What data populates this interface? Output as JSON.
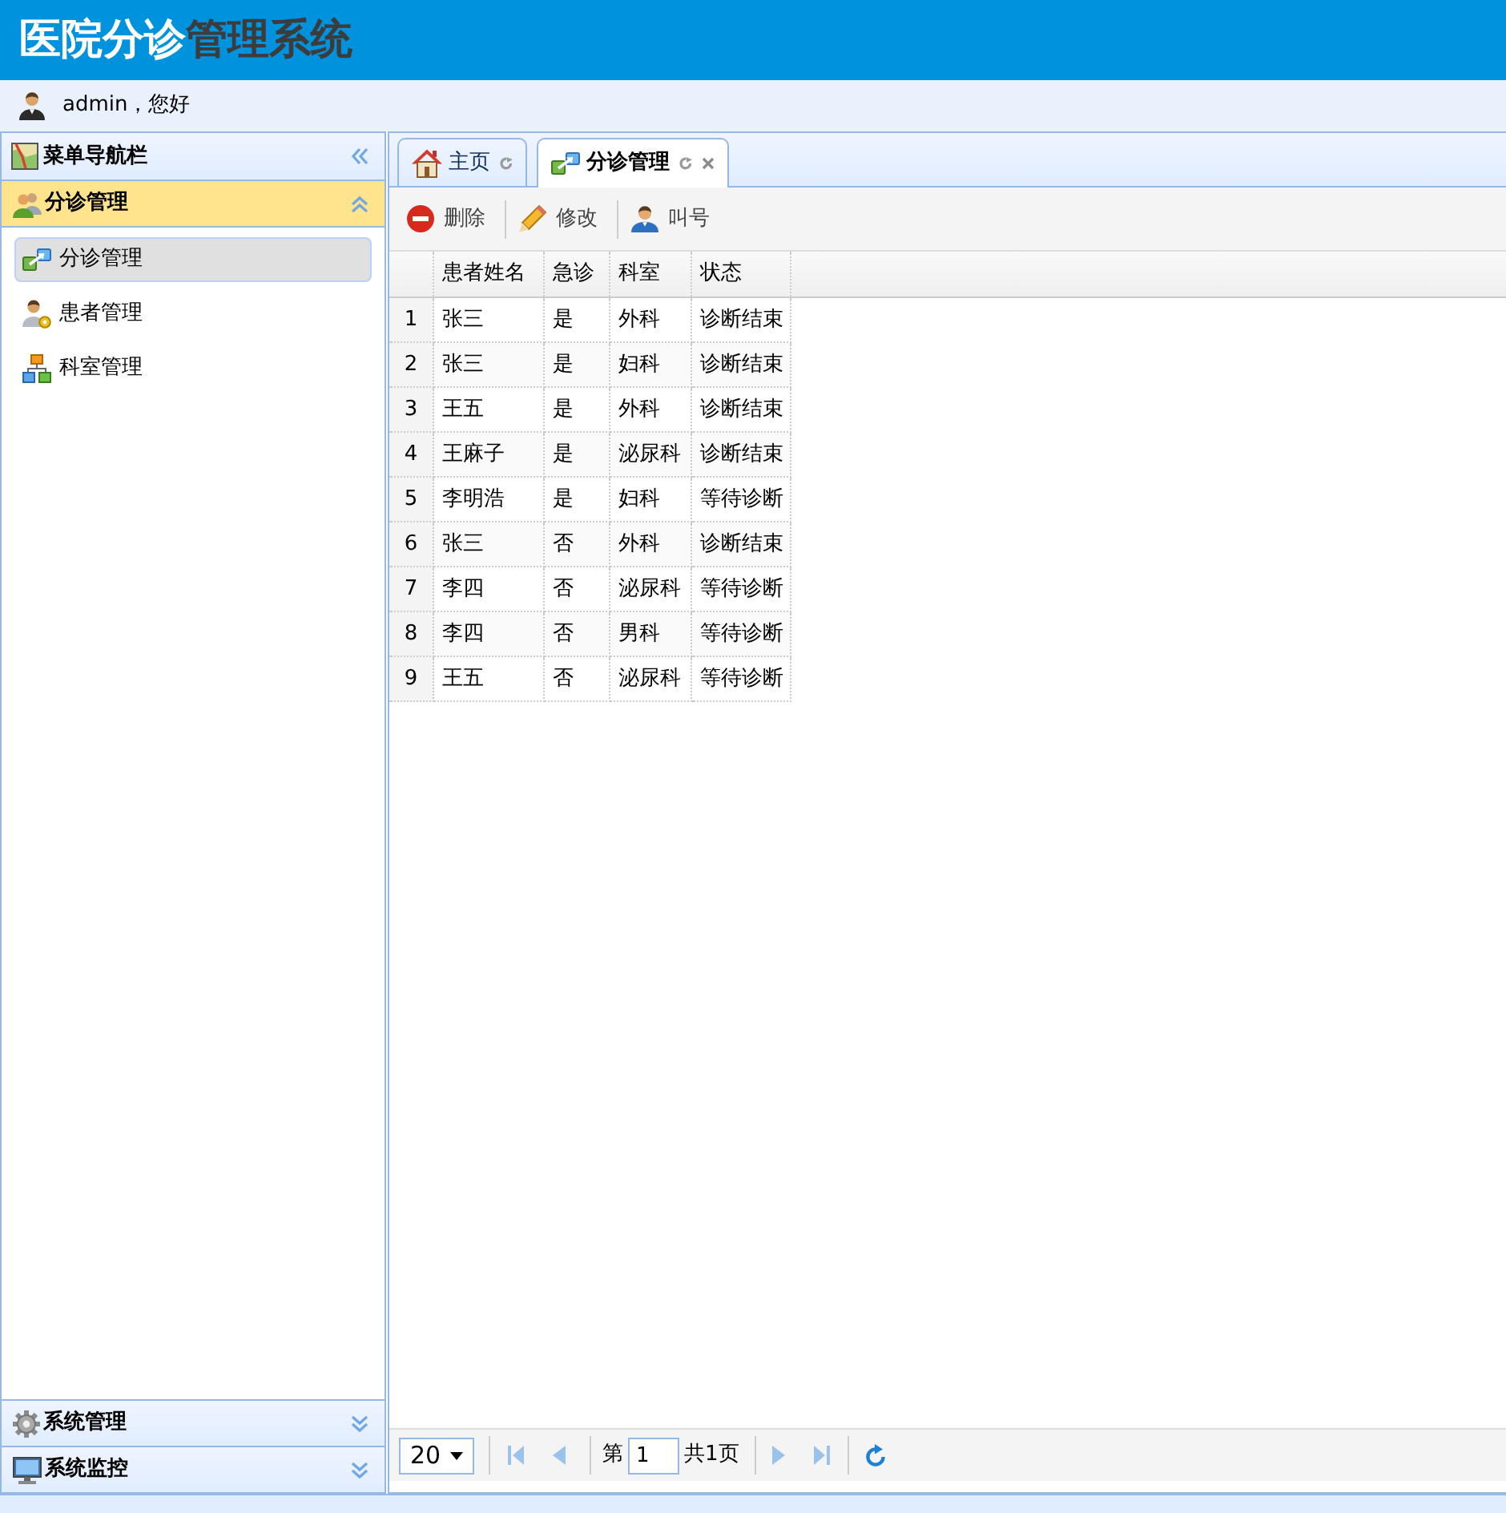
{
  "header": {
    "title": {
      "part_1": "医院分诊",
      "part_2": "管理系统"
    }
  },
  "user_bar": {
    "greeting": "admin，您好"
  },
  "sidebar": {
    "title": "菜单导航栏",
    "sections": [
      {
        "label": "分诊管理",
        "expanded": true,
        "items": [
          {
            "label": "分诊管理",
            "selected": true
          },
          {
            "label": "患者管理",
            "selected": false
          },
          {
            "label": "科室管理",
            "selected": false
          }
        ]
      },
      {
        "label": "系统管理",
        "expanded": false
      },
      {
        "label": "系统监控",
        "expanded": false
      }
    ]
  },
  "tabs": [
    {
      "label": "主页",
      "selected": false,
      "closable": false
    },
    {
      "label": "分诊管理",
      "selected": true,
      "closable": true
    }
  ],
  "toolbar": {
    "buttons": [
      {
        "kind": "delete",
        "label": "删除"
      },
      {
        "kind": "edit",
        "label": "修改"
      },
      {
        "kind": "call",
        "label": "叫号"
      }
    ]
  },
  "table": {
    "columns": [
      "患者姓名",
      "急诊",
      "科室",
      "状态"
    ],
    "rows": [
      {
        "number": "1",
        "selected": false,
        "cells": [
          "张三",
          "是",
          "外科",
          "诊断结束"
        ]
      },
      {
        "number": "2",
        "selected": false,
        "cells": [
          "张三",
          "是",
          "妇科",
          "诊断结束"
        ]
      },
      {
        "number": "3",
        "selected": false,
        "cells": [
          "王五",
          "是",
          "外科",
          "诊断结束"
        ]
      },
      {
        "number": "4",
        "selected": false,
        "cells": [
          "王麻子",
          "是",
          "泌尿科",
          "诊断结束"
        ]
      },
      {
        "number": "5",
        "selected": false,
        "cells": [
          "李明浩",
          "是",
          "妇科",
          "等待诊断"
        ]
      },
      {
        "number": "6",
        "selected": false,
        "cells": [
          "张三",
          "否",
          "外科",
          "诊断结束"
        ]
      },
      {
        "number": "7",
        "selected": false,
        "cells": [
          "李四",
          "否",
          "泌尿科",
          "等待诊断"
        ]
      },
      {
        "number": "8",
        "selected": false,
        "cells": [
          "李四",
          "否",
          "男科",
          "等待诊断"
        ]
      },
      {
        "number": "9",
        "selected": false,
        "cells": [
          "王五",
          "否",
          "泌尿科",
          "等待诊断"
        ]
      }
    ]
  },
  "pager": {
    "page_size": "20",
    "first": {
      "disabled": true
    },
    "previous": {
      "disabled": true
    },
    "page_prefix": "第",
    "page": "1",
    "page_total": "共1页",
    "next": {
      "disabled": true
    },
    "last": {
      "disabled": true
    }
  }
}
